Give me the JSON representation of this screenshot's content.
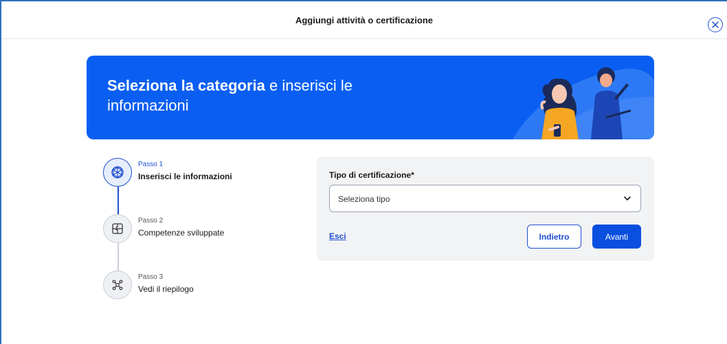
{
  "modal": {
    "title": "Aggiungi attività o certificazione",
    "close_icon": "close-circle-icon"
  },
  "banner": {
    "title_bold": "Seleziona la categoria",
    "title_rest": " e inserisci le informazioni",
    "bg_color": "#0a5ff2"
  },
  "stepper": {
    "steps": [
      {
        "number": "Passo 1",
        "label": "Inserisci le informazioni",
        "icon": "hexagon-icon",
        "state": "active"
      },
      {
        "number": "Passo 2",
        "label": "Competenze sviluppate",
        "icon": "puzzle-icon",
        "state": "inactive"
      },
      {
        "number": "Passo 3",
        "label": "Vedi il riepilogo",
        "icon": "network-icon",
        "state": "inactive"
      }
    ]
  },
  "form": {
    "field_label": "Tipo di certificazione*",
    "select_placeholder": "Seleziona tipo",
    "exit_label": "Esci",
    "back_label": "Indietro",
    "next_label": "Avanti"
  },
  "colors": {
    "accent": "#1f4fd1",
    "primary_button": "#0a4fe0",
    "card_bg": "#f2f3f5"
  }
}
